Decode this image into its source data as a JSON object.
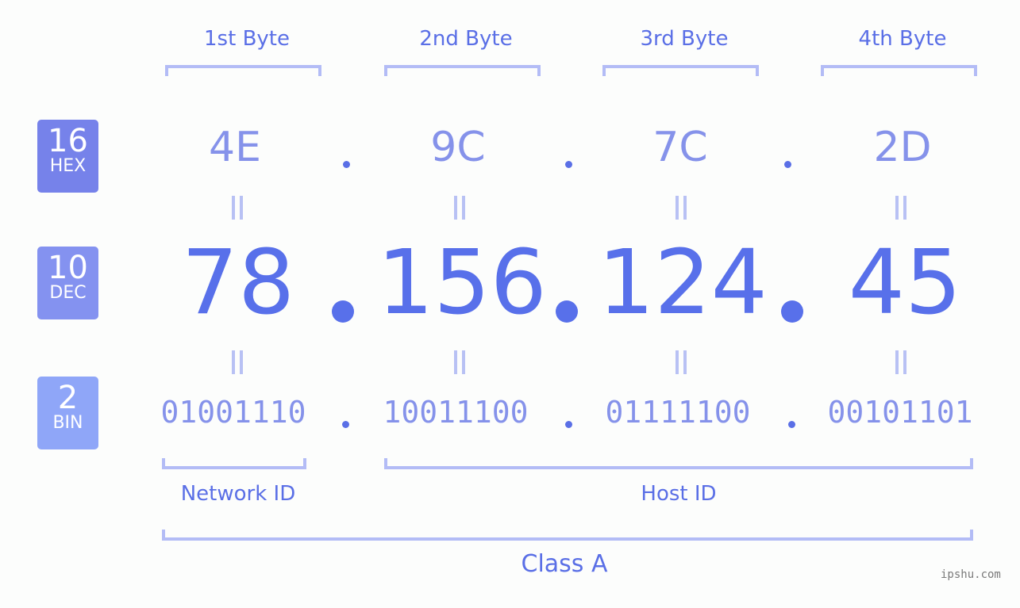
{
  "byte_headers": [
    "1st Byte",
    "2nd Byte",
    "3rd Byte",
    "4th Byte"
  ],
  "badges": {
    "hex": {
      "num": "16",
      "label": "HEX",
      "color": "#7682ea"
    },
    "dec": {
      "num": "10",
      "label": "DEC",
      "color": "#8492f0"
    },
    "bin": {
      "num": "2",
      "label": "BIN",
      "color": "#8fa6f8"
    }
  },
  "ip": {
    "hex": [
      "4E",
      "9C",
      "7C",
      "2D"
    ],
    "dec": [
      "78",
      "156",
      "124",
      "45"
    ],
    "bin": [
      "01001110",
      "10011100",
      "01111100",
      "00101101"
    ]
  },
  "segments": {
    "network_id": "Network ID",
    "host_id": "Host ID",
    "ip_class": "Class A"
  },
  "watermark": "ipshu.com",
  "colors": {
    "primary": "#5870ea",
    "light": "#8592ea",
    "bracket": "#b3bcf6"
  }
}
